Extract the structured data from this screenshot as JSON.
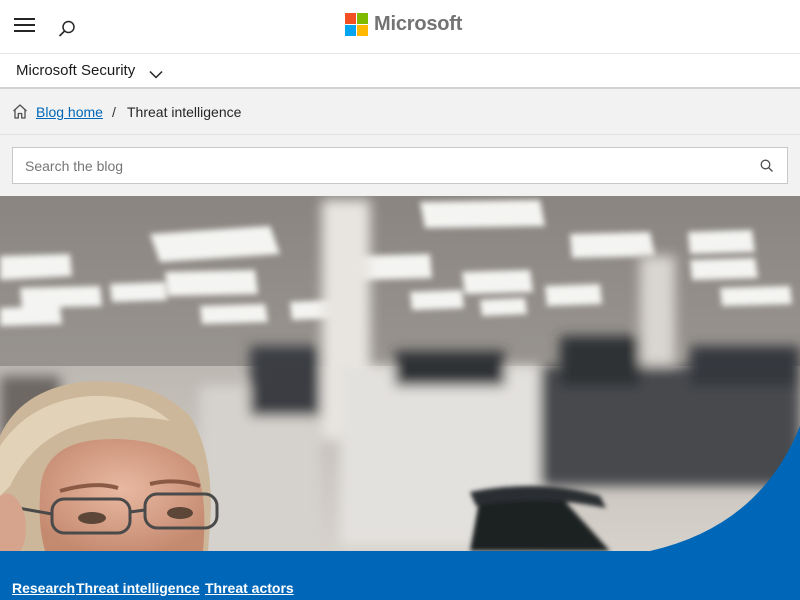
{
  "header": {
    "brand": "Microsoft",
    "menu_icon": "hamburger-menu-icon",
    "search_icon": "search-icon",
    "logo_colors": [
      "#f25022",
      "#7fba00",
      "#00a4ef",
      "#ffb900"
    ]
  },
  "subnav": {
    "title": "Microsoft Security",
    "chevron_icon": "chevron-down-icon"
  },
  "breadcrumb": {
    "home_icon": "home-icon",
    "home_label": "Blog home",
    "separator": "/",
    "current": "Threat intelligence"
  },
  "search": {
    "placeholder": "Search the blog",
    "icon": "search-icon"
  },
  "hero": {
    "image": "office-photo-man-with-glasses"
  },
  "tags": [
    {
      "label": "Research"
    },
    {
      "label": "Threat intelligence"
    },
    {
      "label": "Threat actors"
    }
  ],
  "colors": {
    "accent_blue": "#0067b8",
    "breadcrumb_bg": "#f2f2f2"
  }
}
